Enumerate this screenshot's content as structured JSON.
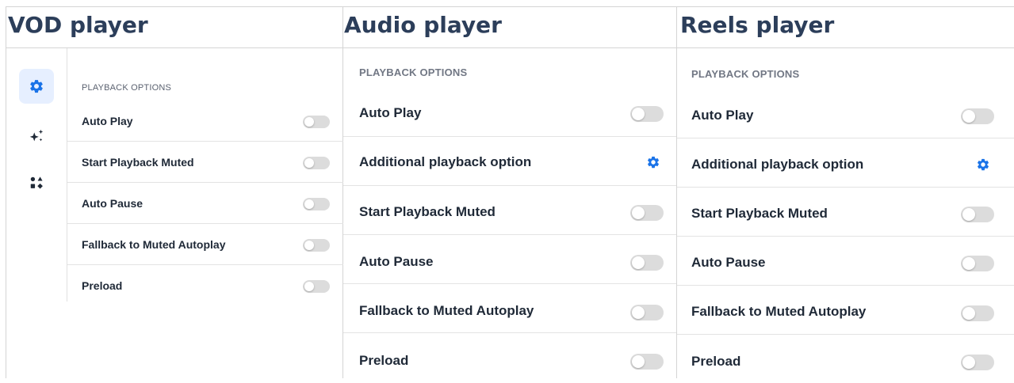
{
  "colors": {
    "accent": "#1a73e8",
    "title": "#2c3e5a",
    "toggle_off": "#dcdcdc",
    "rail_active_bg": "#e6efff"
  },
  "players": {
    "vod": {
      "title": "VOD player",
      "rail": {
        "items": [
          {
            "icon": "gear-icon",
            "active": true
          },
          {
            "icon": "sparkles-icon",
            "active": false
          },
          {
            "icon": "shapes-icon",
            "active": false
          }
        ]
      },
      "section_title": "PLAYBACK OPTIONS",
      "options": [
        {
          "label": "Auto Play",
          "enabled": false
        },
        {
          "label": "Start Playback Muted",
          "enabled": false
        },
        {
          "label": "Auto Pause",
          "enabled": false
        },
        {
          "label": "Fallback to Muted Autoplay",
          "enabled": false
        },
        {
          "label": "Preload",
          "enabled": false
        }
      ]
    },
    "audio": {
      "title": "Audio player",
      "section_title": "PLAYBACK OPTIONS",
      "options": [
        {
          "label": "Auto Play",
          "control": "toggle",
          "enabled": false
        },
        {
          "label": "Additional playback option",
          "control": "gear-icon"
        },
        {
          "label": "Start Playback Muted",
          "control": "toggle",
          "enabled": false
        },
        {
          "label": "Auto Pause",
          "control": "toggle",
          "enabled": false
        },
        {
          "label": "Fallback to Muted Autoplay",
          "control": "toggle",
          "enabled": false
        },
        {
          "label": "Preload",
          "control": "toggle",
          "enabled": false
        }
      ]
    },
    "reels": {
      "title": "Reels player",
      "section_title": "PLAYBACK OPTIONS",
      "options": [
        {
          "label": "Auto Play",
          "control": "toggle",
          "enabled": false
        },
        {
          "label": "Additional playback option",
          "control": "gear-icon"
        },
        {
          "label": "Start Playback Muted",
          "control": "toggle",
          "enabled": false
        },
        {
          "label": "Auto Pause",
          "control": "toggle",
          "enabled": false
        },
        {
          "label": "Fallback to Muted Autoplay",
          "control": "toggle",
          "enabled": false
        },
        {
          "label": "Preload",
          "control": "toggle",
          "enabled": false
        }
      ]
    }
  }
}
